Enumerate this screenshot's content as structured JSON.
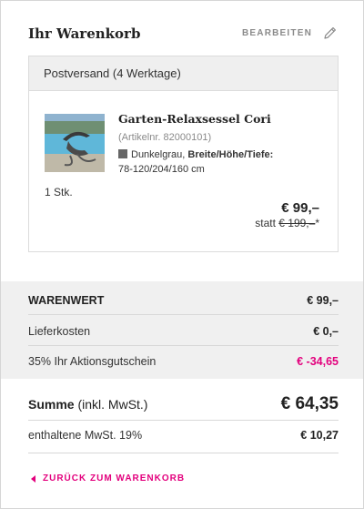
{
  "header": {
    "title": "Ihr Warenkorb",
    "edit_label": "BEARBEITEN",
    "edit_icon": "pencil-icon"
  },
  "shipment": {
    "method": "Postversand (4 Werktage)",
    "item": {
      "name": "Garten-Relaxsessel Cori",
      "article": "(Artikelnr. 82000101)",
      "color": "Dunkelgrau,",
      "dims_label": "Breite/Höhe/Tiefe:",
      "dims_value": "78-120/204/160 cm",
      "quantity": "1 Stk.",
      "price": "€ 99,–",
      "statt_label": "statt",
      "old_price": "€ 199,–",
      "old_price_mark": "*"
    }
  },
  "summary": {
    "warenwert_label": "WARENWERT",
    "warenwert_value": "€ 99,–",
    "liefer_label": "Lieferkosten",
    "liefer_value": "€ 0,–",
    "gutschein_label": "35% Ihr Aktionsgutschein",
    "gutschein_value": "€ -34,65"
  },
  "totals": {
    "summe_label": "Summe",
    "summe_suffix": " (inkl. MwSt.)",
    "summe_value": "€ 64,35",
    "tax_label": "enthaltene MwSt. 19%",
    "tax_value": "€ 10,27"
  },
  "back": {
    "label": "ZURÜCK ZUM WARENKORB",
    "icon": "caret-left-icon"
  },
  "colors": {
    "accent": "#e3007d",
    "summary_bg": "#f0f0f0",
    "ship_header_bg": "#efefef"
  }
}
